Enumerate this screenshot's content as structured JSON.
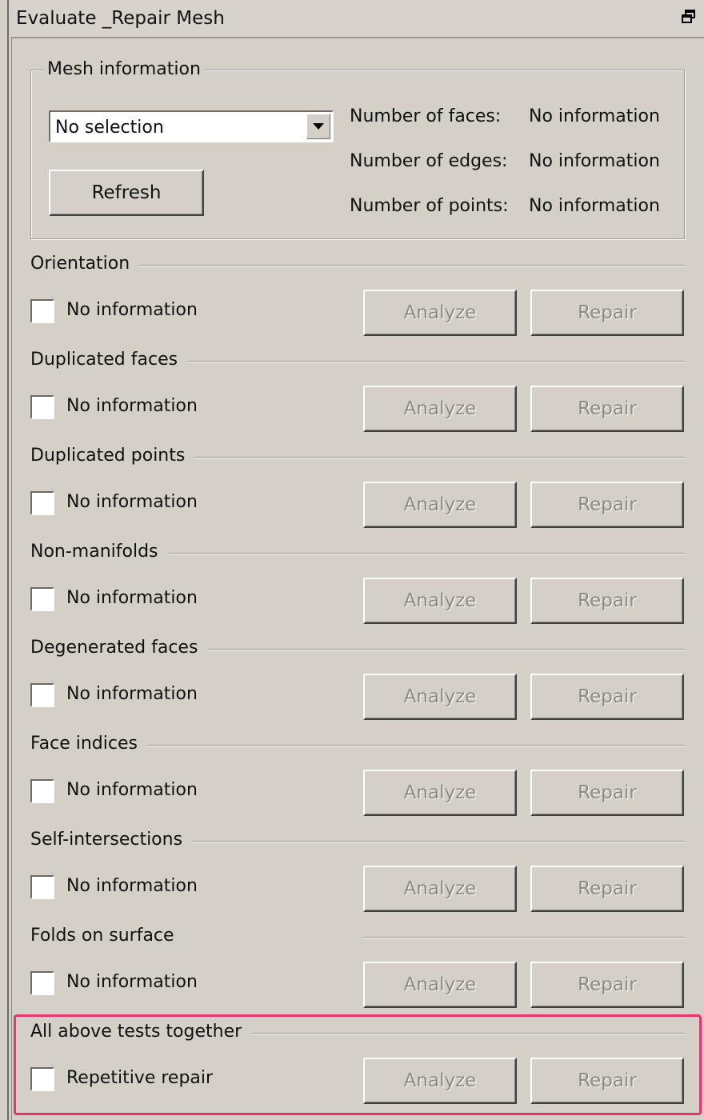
{
  "window": {
    "title": "Evaluate _Repair Mesh",
    "restore_icon": "restore-window-icon"
  },
  "mesh_info": {
    "legend": "Mesh information",
    "selection_value": "No selection",
    "refresh_label": "Refresh",
    "faces_label": "Number of faces:",
    "faces_value": "No information",
    "edges_label": "Number of edges:",
    "edges_value": "No information",
    "points_label": "Number of points:",
    "points_value": "No information"
  },
  "sections": [
    {
      "title": "Orientation",
      "status": "No information",
      "analyze": "Analyze",
      "repair": "Repair"
    },
    {
      "title": "Duplicated faces",
      "status": "No information",
      "analyze": "Analyze",
      "repair": "Repair"
    },
    {
      "title": "Duplicated points",
      "status": "No information",
      "analyze": "Analyze",
      "repair": "Repair"
    },
    {
      "title": "Non-manifolds",
      "status": "No information",
      "analyze": "Analyze",
      "repair": "Repair"
    },
    {
      "title": "Degenerated faces",
      "status": "No information",
      "analyze": "Analyze",
      "repair": "Repair"
    },
    {
      "title": "Face indices",
      "status": "No information",
      "analyze": "Analyze",
      "repair": "Repair"
    },
    {
      "title": "Self-intersections",
      "status": "No information",
      "analyze": "Analyze",
      "repair": "Repair"
    },
    {
      "title": "Folds on surface",
      "status": "No information",
      "analyze": "Analyze",
      "repair": "Repair"
    },
    {
      "title": "All above tests together",
      "status": "Repetitive repair",
      "analyze": "Analyze",
      "repair": "Repair"
    }
  ],
  "colors": {
    "background": "#d4d0c8",
    "highlight": "#e8336b",
    "disabled_text": "#8c8882"
  }
}
